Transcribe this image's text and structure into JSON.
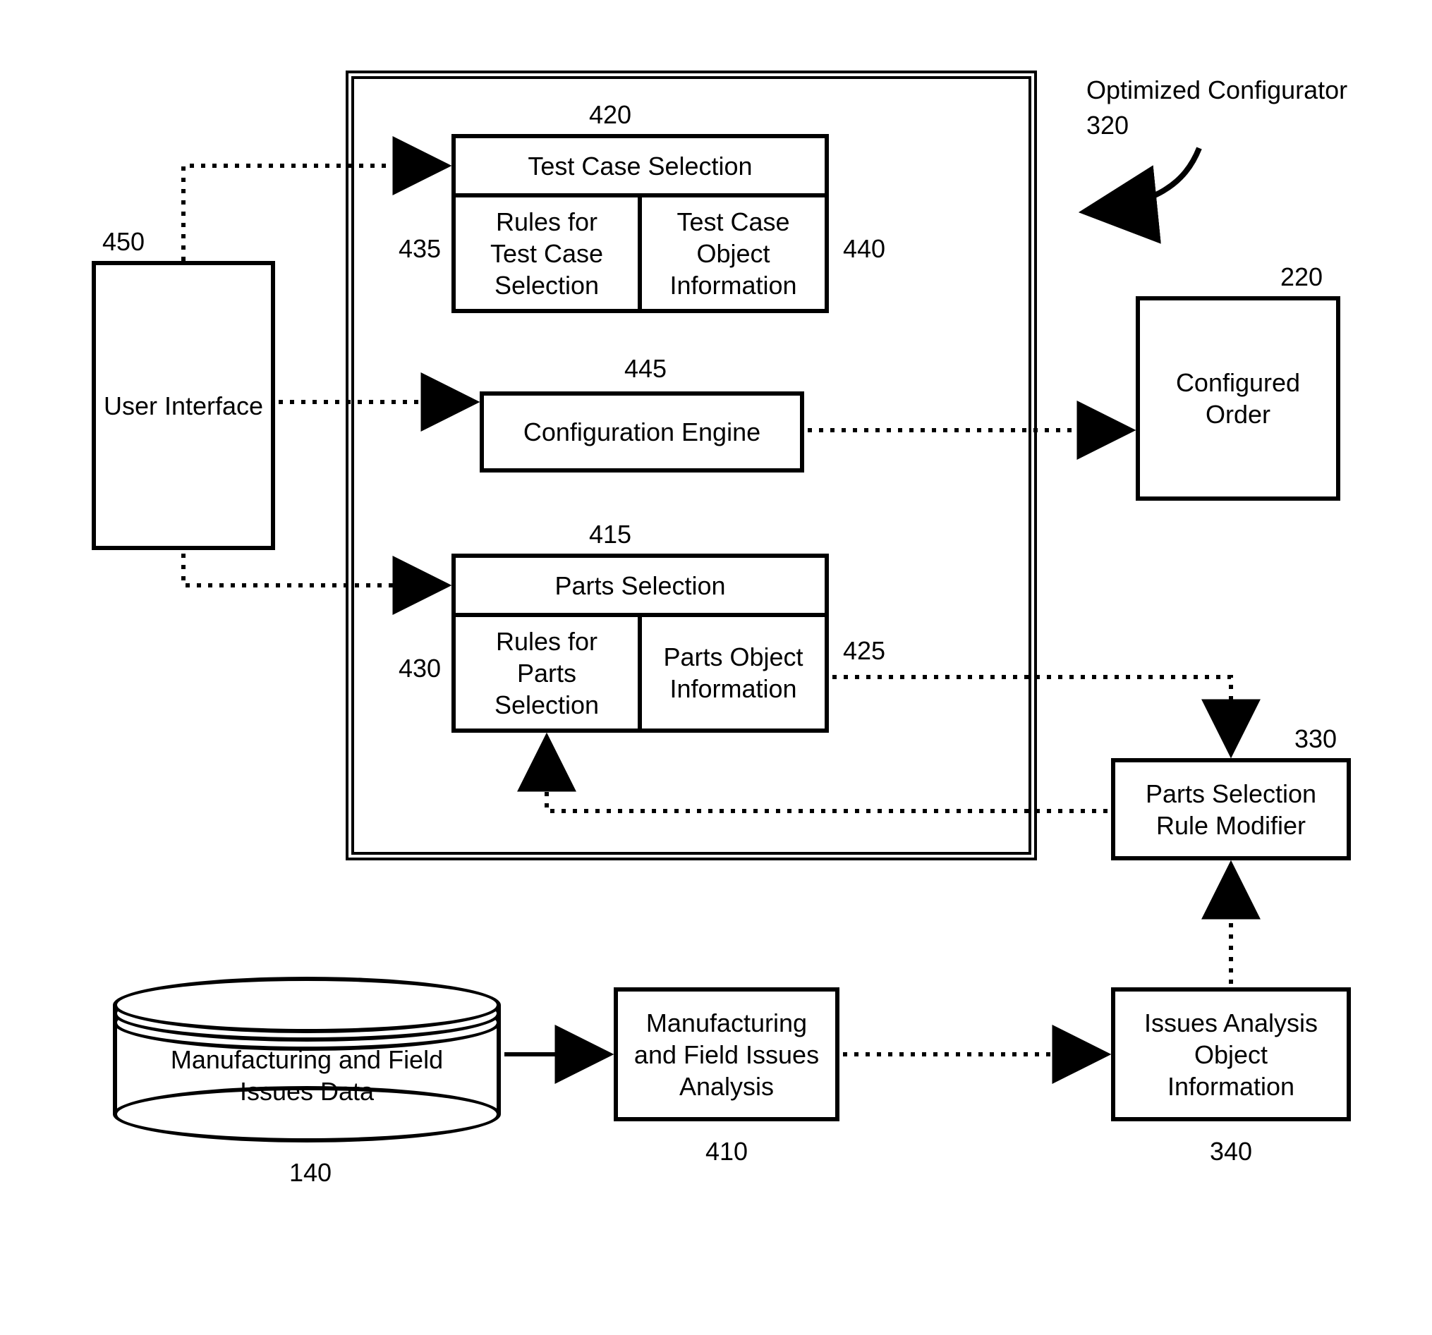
{
  "annotation": {
    "title": "Optimized Configurator",
    "ref": "320"
  },
  "userInterface": {
    "label": "User Interface",
    "ref": "450"
  },
  "configurator": {
    "testCaseSelection": {
      "header": "Test Case Selection",
      "ref": "420",
      "rules": {
        "label": "Rules for\nTest Case\nSelection",
        "ref": "435"
      },
      "object": {
        "label": "Test Case\nObject\nInformation",
        "ref": "440"
      }
    },
    "configEngine": {
      "label": "Configuration Engine",
      "ref": "445"
    },
    "partsSelection": {
      "header": "Parts Selection",
      "ref": "415",
      "rules": {
        "label": "Rules for\nParts\nSelection",
        "ref": "430"
      },
      "object": {
        "label": "Parts Object\nInformation",
        "ref": "425"
      }
    }
  },
  "configuredOrder": {
    "label": "Configured\nOrder",
    "ref": "220"
  },
  "ruleModifier": {
    "label": "Parts Selection\nRule Modifier",
    "ref": "330"
  },
  "issuesData": {
    "label": "Manufacturing and Field\nIssues Data",
    "ref": "140"
  },
  "issuesAnalysis": {
    "label": "Manufacturing\nand Field Issues\nAnalysis",
    "ref": "410"
  },
  "issuesAnalysisObj": {
    "label": "Issues Analysis\nObject\nInformation",
    "ref": "340"
  }
}
